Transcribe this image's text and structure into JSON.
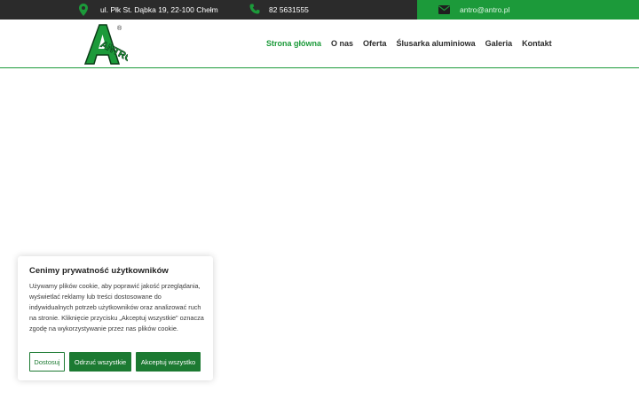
{
  "topbar": {
    "address": "ul. Płk St. Dąbka 19, 22-100 Chełm",
    "phone": "82 5631555",
    "email": "antro@antro.pl",
    "icons": {
      "address": "map-pin-icon",
      "phone": "phone-icon",
      "email": "envelope-icon"
    }
  },
  "nav": {
    "items": [
      {
        "label": "Strona główna",
        "active": true
      },
      {
        "label": "O nas"
      },
      {
        "label": "Oferta"
      },
      {
        "label": "Ślusarka aluminiowa"
      },
      {
        "label": "Galeria"
      },
      {
        "label": "Kontakt"
      }
    ]
  },
  "logo": {
    "text": "ANTRO",
    "registered": "®"
  },
  "cookie": {
    "title": "Cenimy prywatność użytkowników",
    "body": "Używamy plików cookie, aby poprawić jakość przeglądania, wyświetlać reklamy lub treści dostosowane do indywidualnych potrzeb użytkowników oraz analizować ruch na stronie. Kliknięcie przycisku „Akceptuj wszystkie\" oznacza zgodę na wykorzystywanie przez nas plików cookie.",
    "customize_label": "Dostosuj",
    "reject_label": "Odrzuć wszystkie",
    "accept_label": "Akceptuj wszystko"
  },
  "colors": {
    "brand": "#1c9a3a",
    "dark": "#2b2b2b",
    "button": "#1c7a32"
  }
}
